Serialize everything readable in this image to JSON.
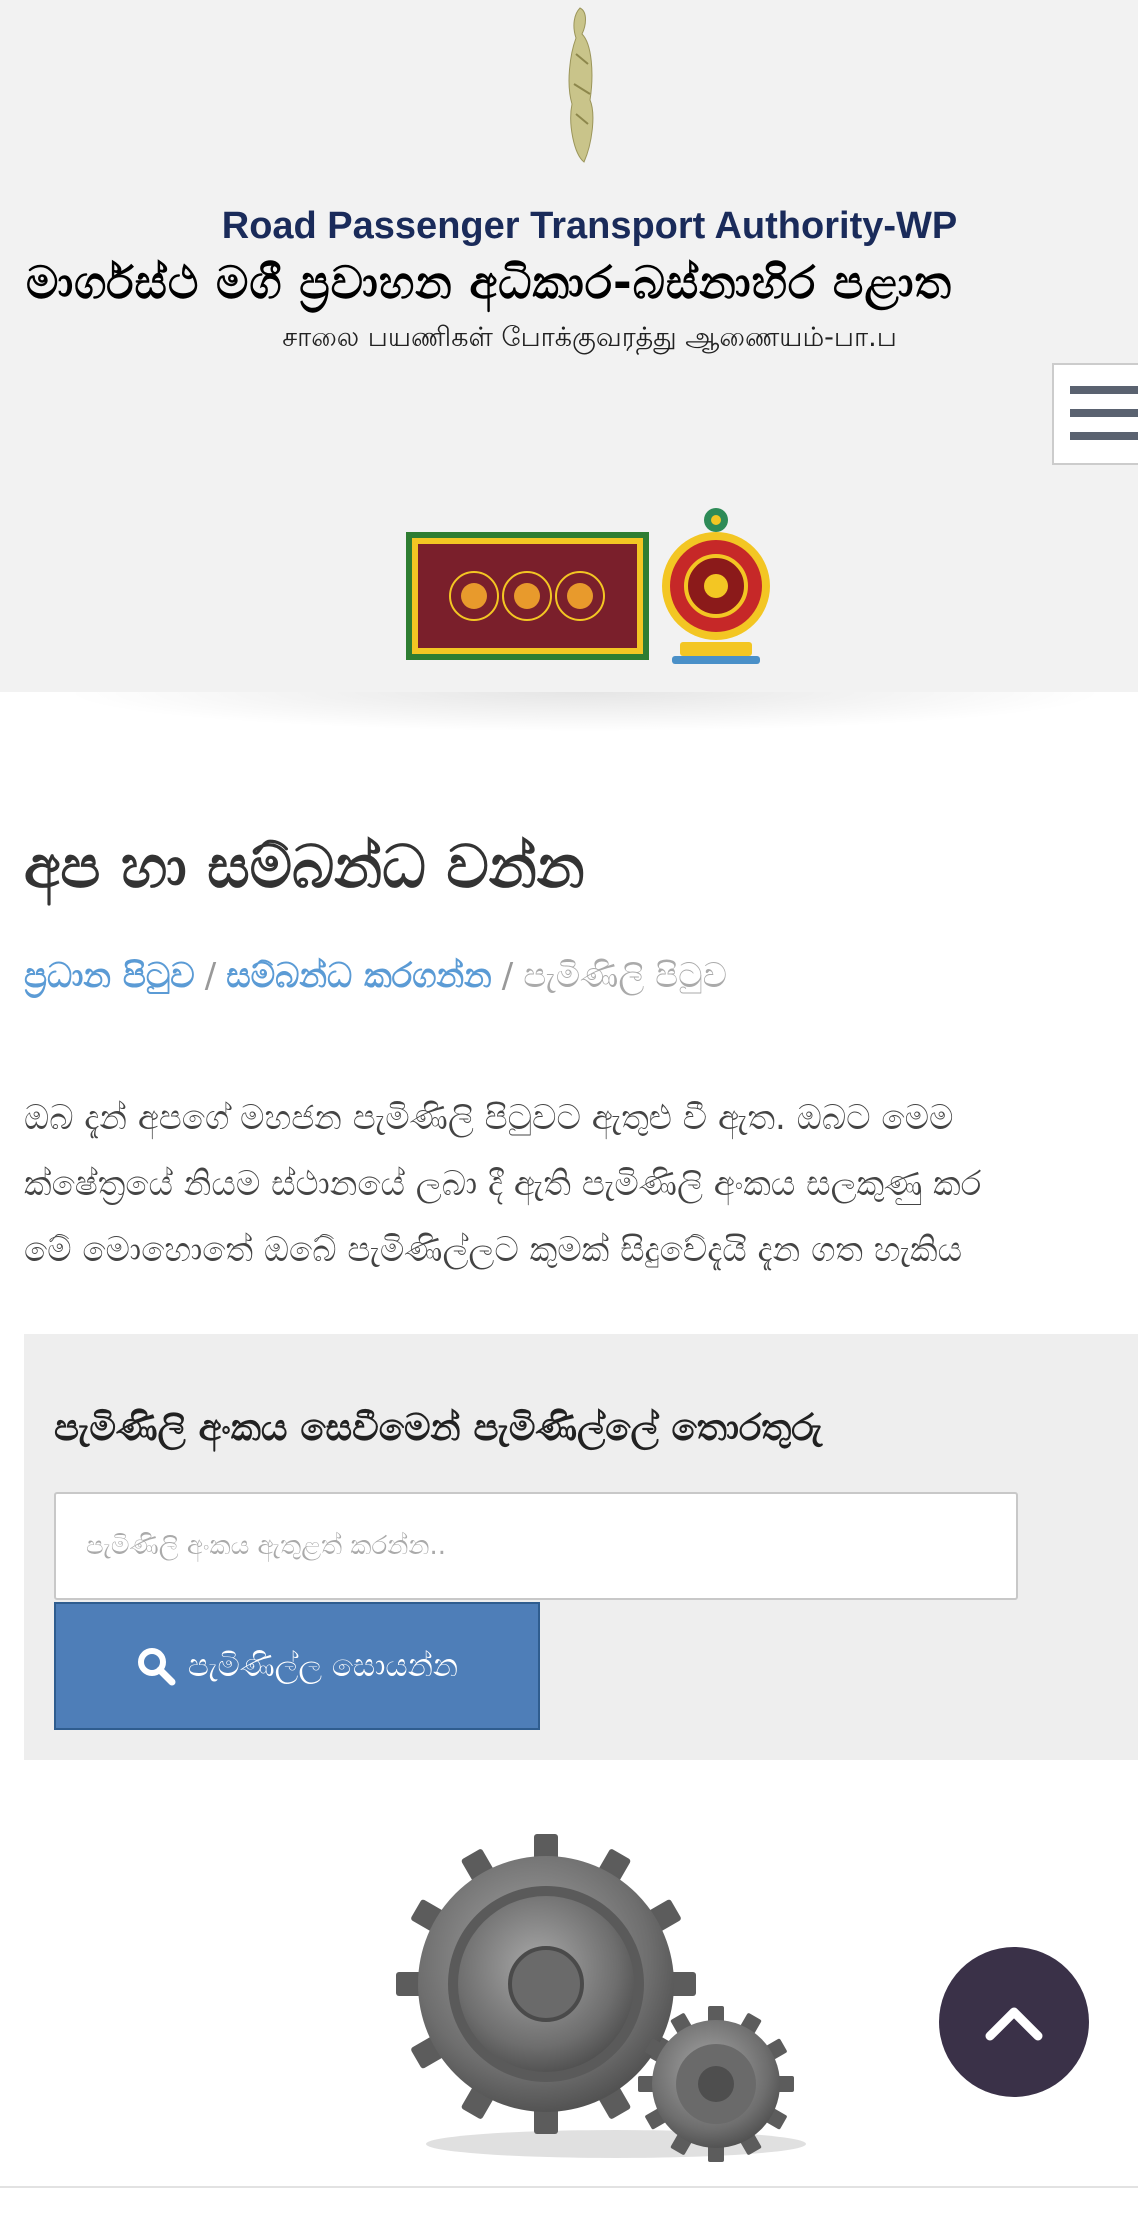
{
  "header": {
    "title_en": "Road Passenger Transport Authority-WP",
    "title_si": "මාර්ගස්ථ මගී ප්‍රවාහන අධිකාර-බස්නාහිර පළාත",
    "title_ta": "சாலை பயணிகள் போக்குவரத்து ஆணையம்-பா.ப",
    "menu_icon": "hamburger-icon",
    "emblem_icon": "emblem-icon",
    "flag_icon": "province-flag",
    "crest_icon": "state-crest"
  },
  "page": {
    "title": "අප හා සම්බන්ධ වන්න"
  },
  "breadcrumb": {
    "home": "ප්‍රධාන පිටුව",
    "separator": "/",
    "contact": "සම්බන්ධ කරගන්න",
    "current": "පැමිණිලි පිටුව"
  },
  "intro": {
    "line1": "ඔබ දැන් අපගේ මහජන පැමිණිලි පිටුවට ඇතුළු වී ඇත. ඔබට මෙම",
    "line2": "ක්ෂේත්‍රයේ නියම ස්ථානයේ ලබා දී ඇති පැමිණිලි අංකය සලකුණු කර",
    "line3": "මේ මොහොතේ ඔබේ පැමිණිල්ලට කුමක් සිදුවේදැයි දැන ගත හැකිය"
  },
  "search": {
    "heading": "පැමිණිලි අංකය සෙවීමෙන් පැමිණිල්ලේ තොරතුරු",
    "placeholder": "පැමිණිලි අංකය ඇතුළත් කරන්න..",
    "value": "",
    "button_label": "පැමිණිල්ල සොයන්න",
    "button_icon": "search-icon"
  },
  "footer": {
    "illustration": "gears-illustration",
    "scroll_top_icon": "chevron-up-icon"
  },
  "colors": {
    "header_bg": "#f2f2f2",
    "title_en": "#1a2b5a",
    "link": "#5b9bd5",
    "button_bg": "#4e7eb8",
    "scroll_top_bg": "#3a3148",
    "panel_bg": "#eeeeee"
  }
}
